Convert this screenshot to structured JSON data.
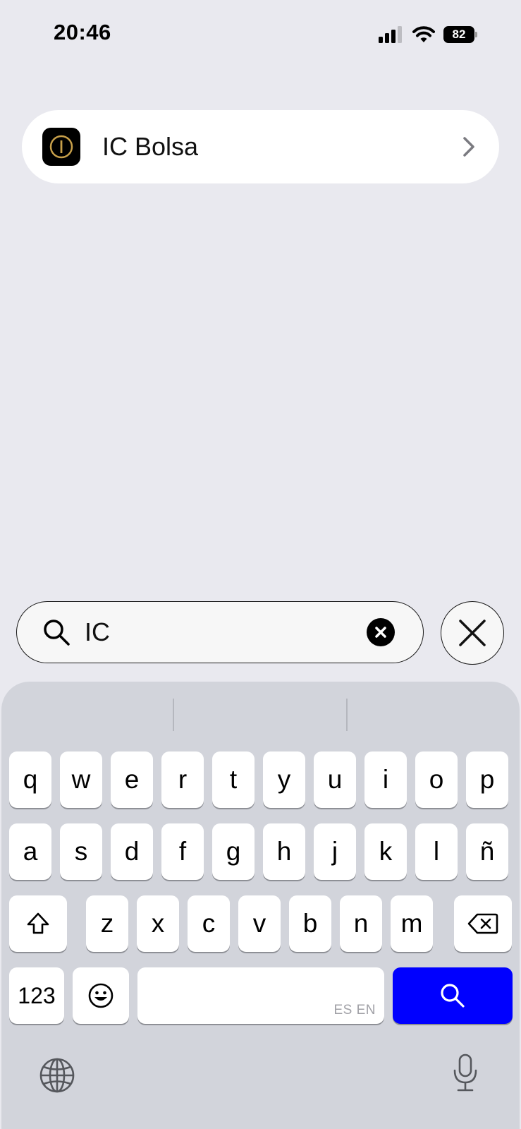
{
  "status_bar": {
    "time": "20:46",
    "battery_level": "82",
    "icons": [
      "signal-icon",
      "wifi-icon",
      "battery-icon"
    ]
  },
  "results": [
    {
      "title": "IC Bolsa",
      "icon": "ic-bolsa-app-icon",
      "accent": "#C8A04A"
    }
  ],
  "search": {
    "value": "IC"
  },
  "keyboard": {
    "row1": [
      "q",
      "w",
      "e",
      "r",
      "t",
      "y",
      "u",
      "i",
      "o",
      "p"
    ],
    "row2": [
      "a",
      "s",
      "d",
      "f",
      "g",
      "h",
      "j",
      "k",
      "l",
      "ñ"
    ],
    "row3": [
      "z",
      "x",
      "c",
      "v",
      "b",
      "n",
      "m"
    ],
    "numbers_label": "123",
    "space_language_label": "ES EN",
    "search_key_color": "#0000FF"
  }
}
